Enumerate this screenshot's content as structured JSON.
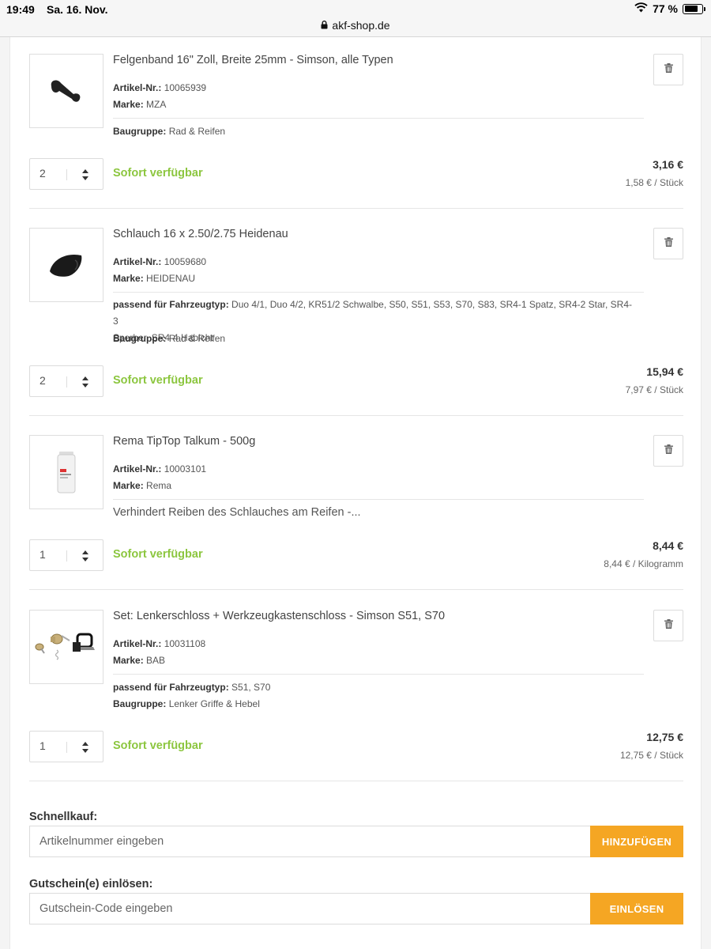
{
  "statusbar": {
    "time": "19:49",
    "date": "Sa. 16. Nov.",
    "battery": "77 %",
    "battery_level_pct": 77
  },
  "browser": {
    "url": "akf-shop.de"
  },
  "labels": {
    "article_no": "Artikel-Nr.:",
    "brand": "Marke:",
    "group": "Baugruppe:",
    "fits": "passend für Fahrzeugtyp:"
  },
  "cart": {
    "items": [
      {
        "title": "Felgenband 16\" Zoll, Breite 25mm - Simson, alle Typen",
        "article_no": "10065939",
        "brand": "MZA",
        "group": "Rad & Reifen",
        "qty": "2",
        "availability": "Sofort verfügbar",
        "total": "3,16 €",
        "unit_price": "1,58 € / Stück"
      },
      {
        "title": "Schlauch 16 x 2.50/2.75 Heidenau",
        "article_no": "10059680",
        "brand": "HEIDENAU",
        "fits_line1": "Duo 4/1, Duo 4/2, KR51/2 Schwalbe, S50, S51, S53, S70, S83, SR4-1 Spatz, SR4-2 Star, SR4-3",
        "fits_line2": "Sperber, SR4-4 Habicht",
        "group": "Rad & Reifen",
        "qty": "2",
        "availability": "Sofort verfügbar",
        "total": "15,94 €",
        "unit_price": "7,97 € / Stück"
      },
      {
        "title": "Rema TipTop Talkum - 500g",
        "article_no": "10003101",
        "brand": "Rema",
        "description": "Verhindert Reiben des Schlauches am Reifen -...",
        "qty": "1",
        "availability": "Sofort verfügbar",
        "total": "8,44 €",
        "unit_price": "8,44 € / Kilogramm"
      },
      {
        "title": "Set: Lenkerschloss + Werkzeugkastenschloss - Simson S51, S70",
        "article_no": "10031108",
        "brand": "BAB",
        "fits": "S51, S70",
        "group": "Lenker Griffe & Hebel",
        "qty": "1",
        "availability": "Sofort verfügbar",
        "total": "12,75 €",
        "unit_price": "12,75 € / Stück"
      }
    ]
  },
  "quickbuy": {
    "label": "Schnellkauf:",
    "placeholder": "Artikelnummer eingeben",
    "button": "HINZUFÜGEN"
  },
  "voucher": {
    "label": "Gutschein(e) einlösen:",
    "placeholder": "Gutschein-Code eingeben",
    "button": "EINLÖSEN"
  },
  "colors": {
    "accent_green": "#8cc63f",
    "button_orange": "#f5a623"
  }
}
